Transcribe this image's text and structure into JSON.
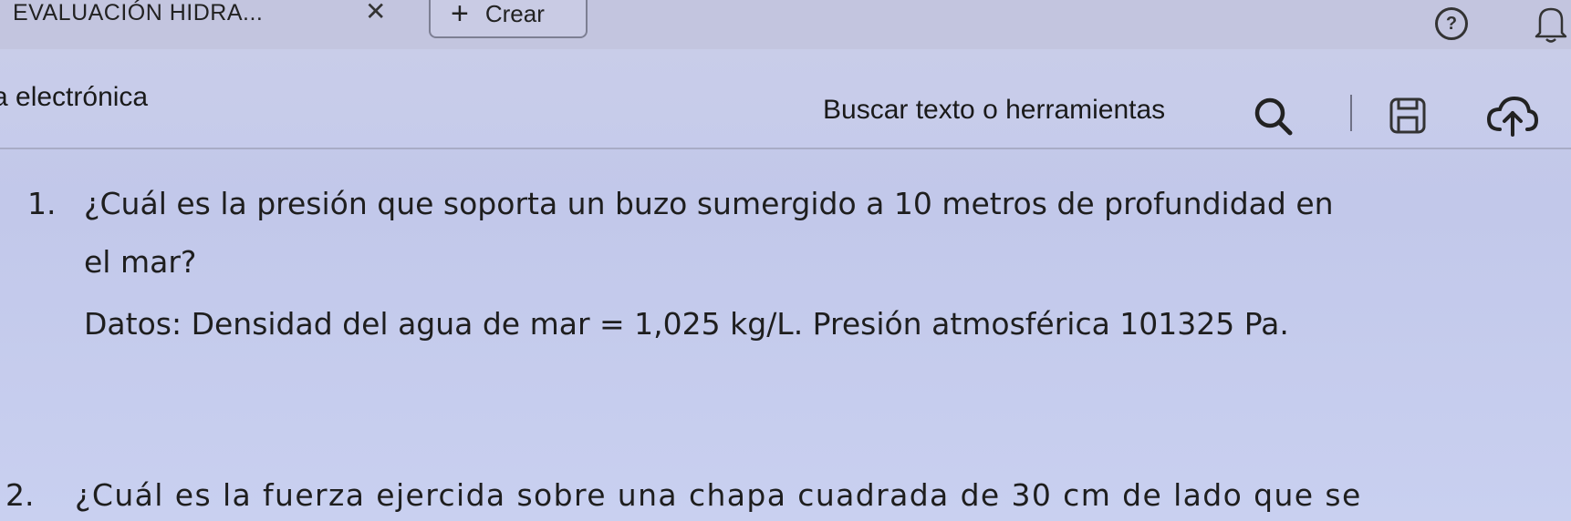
{
  "tabbar": {
    "tab_title": "EVALUACIÓN HIDRA...",
    "close_glyph": "✕",
    "new_tab_plus": "+",
    "new_tab_label": "Crear",
    "help_glyph": "?"
  },
  "toolbar": {
    "doc_title": "a electrónica",
    "search_label": "Buscar texto o herramientas"
  },
  "document": {
    "q1_number": "1.",
    "q1_line1": "¿Cuál es la presión que soporta un buzo sumergido a 10 metros de profundidad en",
    "q1_line2": "el mar?",
    "q1_data": "Datos: Densidad del agua de mar = 1,025 kg/L. Presión atmosférica 101325 Pa.",
    "q2_number": "2.",
    "q2_line1": "¿Cuál es la fuerza ejercida sobre una chapa cuadrada de 30 cm de lado que se"
  },
  "icons": {
    "help": "help-icon",
    "notifications": "bell-icon",
    "search": "search-icon",
    "save": "save-icon",
    "upload": "cloud-upload-icon"
  }
}
